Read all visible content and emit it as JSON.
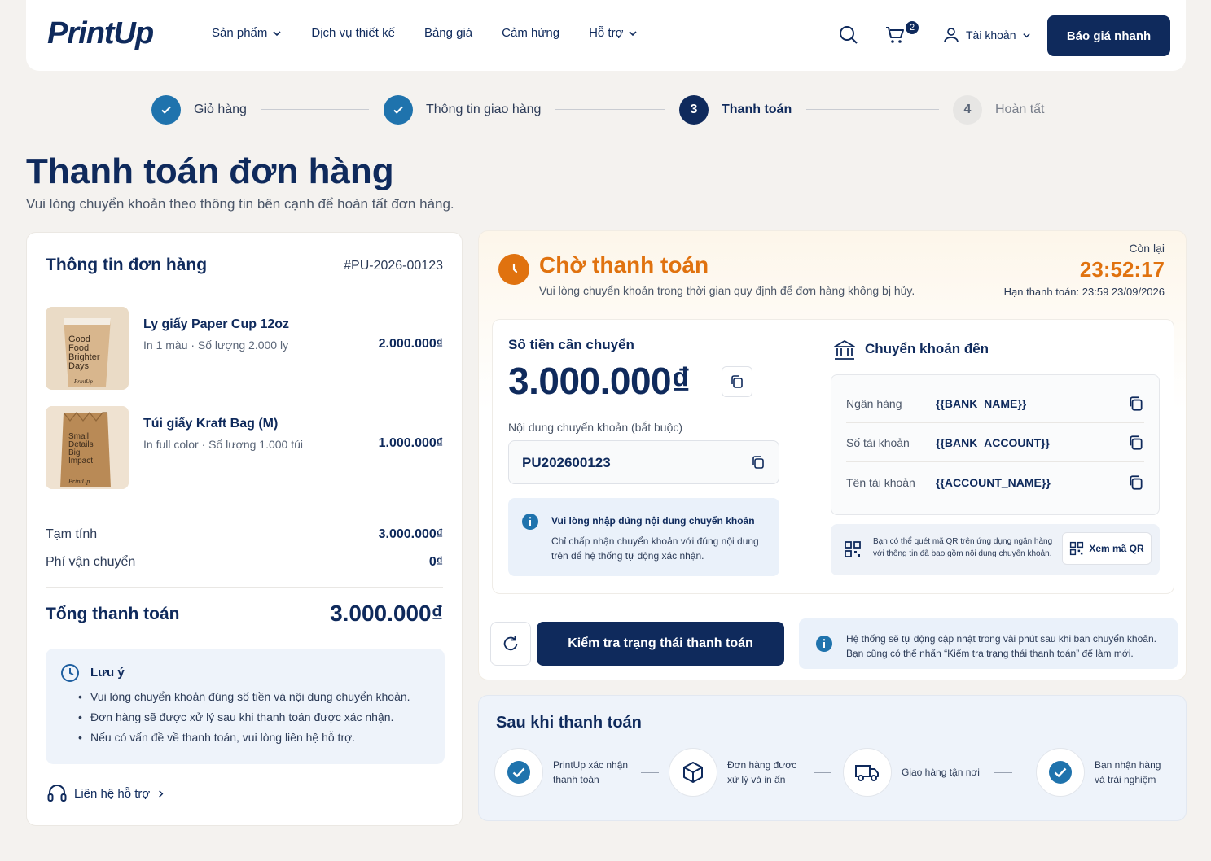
{
  "header": {
    "logo": "PrintUp",
    "nav": [
      {
        "label": "Sản phẩm",
        "has_dropdown": true
      },
      {
        "label": "Dịch vụ thiết kế",
        "has_dropdown": false
      },
      {
        "label": "Bảng giá",
        "has_dropdown": false
      },
      {
        "label": "Cảm hứng",
        "has_dropdown": false
      },
      {
        "label": "Hỗ trợ",
        "has_dropdown": true
      }
    ],
    "cart_count": "2",
    "account_label": "Tài khoản",
    "quote_button": "Báo giá nhanh"
  },
  "stepper": [
    {
      "label": "Giỏ hàng",
      "state": "done",
      "num": ""
    },
    {
      "label": "Thông tin giao hàng",
      "state": "done",
      "num": ""
    },
    {
      "label": "Thanh toán",
      "state": "active",
      "num": "3"
    },
    {
      "label": "Hoàn tất",
      "state": "pending",
      "num": "4"
    }
  ],
  "page": {
    "title": "Thanh toán đơn hàng",
    "subtitle": "Vui lòng chuyển khoản theo thông tin bên cạnh để hoàn tất đơn hàng."
  },
  "order": {
    "title": "Thông tin đơn hàng",
    "order_id": "#PU-2026-00123",
    "items": [
      {
        "name": "Ly giấy Paper Cup 12oz",
        "desc": "In 1 màu · Số lượng 2.000 ly",
        "price": "2.000.000₫",
        "thumb_text": "Good Food Brighter Days",
        "thumb_brand": "PrintUp"
      },
      {
        "name": "Túi giấy Kraft Bag (M)",
        "desc": "In full color · Số lượng 1.000 túi",
        "price": "1.000.000₫",
        "thumb_text": "Small Details Big Impact",
        "thumb_brand": "PrintUp"
      }
    ],
    "subtotal_label": "Tạm tính",
    "subtotal_value": "3.000.000₫",
    "shipping_label": "Phí vận chuyển",
    "shipping_value": "0₫",
    "total_label": "Tổng thanh toán",
    "total_value": "3.000.000₫",
    "note": {
      "title": "Lưu ý",
      "items": [
        "Vui lòng chuyển khoản đúng số tiền và nội dung chuyển khoản.",
        "Đơn hàng sẽ được xử lý sau khi thanh toán được xác nhận.",
        "Nếu có vấn đề về thanh toán, vui lòng liên hệ hỗ trợ."
      ]
    },
    "support_link": "Liên hệ hỗ trợ"
  },
  "payment": {
    "status_title": "Chờ thanh toán",
    "status_sub": "Vui lòng chuyển khoản trong thời gian quy định để đơn hàng không bị hủy.",
    "remaining_label": "Còn lại",
    "timer": "23:52:17",
    "deadline_label": "Hạn thanh toán:",
    "deadline_value": "23:59 23/09/2026",
    "amount_label": "Số tiền cần chuyển",
    "amount_value": "3.000.000₫",
    "content_label": "Nội dung chuyển khoản (bắt buộc)",
    "content_value": "PU202600123",
    "info_title": "Vui lòng nhập đúng nội dung chuyển khoản",
    "info_text": "Chỉ chấp nhận chuyển khoản với đúng nội dung trên để hệ thống tự động xác nhận.",
    "bank_title": "Chuyển khoản đến",
    "bank_rows": [
      {
        "label": "Ngân hàng",
        "value": "{{BANK_NAME}}"
      },
      {
        "label": "Số tài khoản",
        "value": "{{BANK_ACCOUNT}}"
      },
      {
        "label": "Tên tài khoản",
        "value": "{{ACCOUNT_NAME}}"
      }
    ],
    "qr_text": "Bạn có thể quét mã QR trên ứng dụng ngân hàng với thông tin đã bao gồm nội dung chuyển khoản.",
    "qr_button": "Xem mã QR",
    "check_button": "Kiểm tra trạng thái thanh toán",
    "auto_text_1": "Hệ thống sẽ tự động cập nhật trong vài phút sau khi bạn chuyển khoản.",
    "auto_text_2": "Bạn cũng có thể nhấn “Kiểm tra trạng thái thanh toán” để làm mới."
  },
  "after": {
    "title": "Sau khi thanh toán",
    "steps": [
      {
        "label_1": "PrintUp xác nhận",
        "label_2": "thanh toán",
        "icon": "check-icon"
      },
      {
        "label_1": "Đơn hàng được",
        "label_2": "xử lý và in ấn",
        "icon": "box-icon"
      },
      {
        "label_1": "Giao hàng tận nơi",
        "label_2": "",
        "icon": "truck-icon"
      },
      {
        "label_1": "Bạn nhận hàng",
        "label_2": "và trải nghiệm",
        "icon": "check-icon"
      }
    ]
  },
  "colors": {
    "navy": "#0f2a5c",
    "accent_orange": "#e0720f",
    "check_blue": "#1f73ad"
  }
}
